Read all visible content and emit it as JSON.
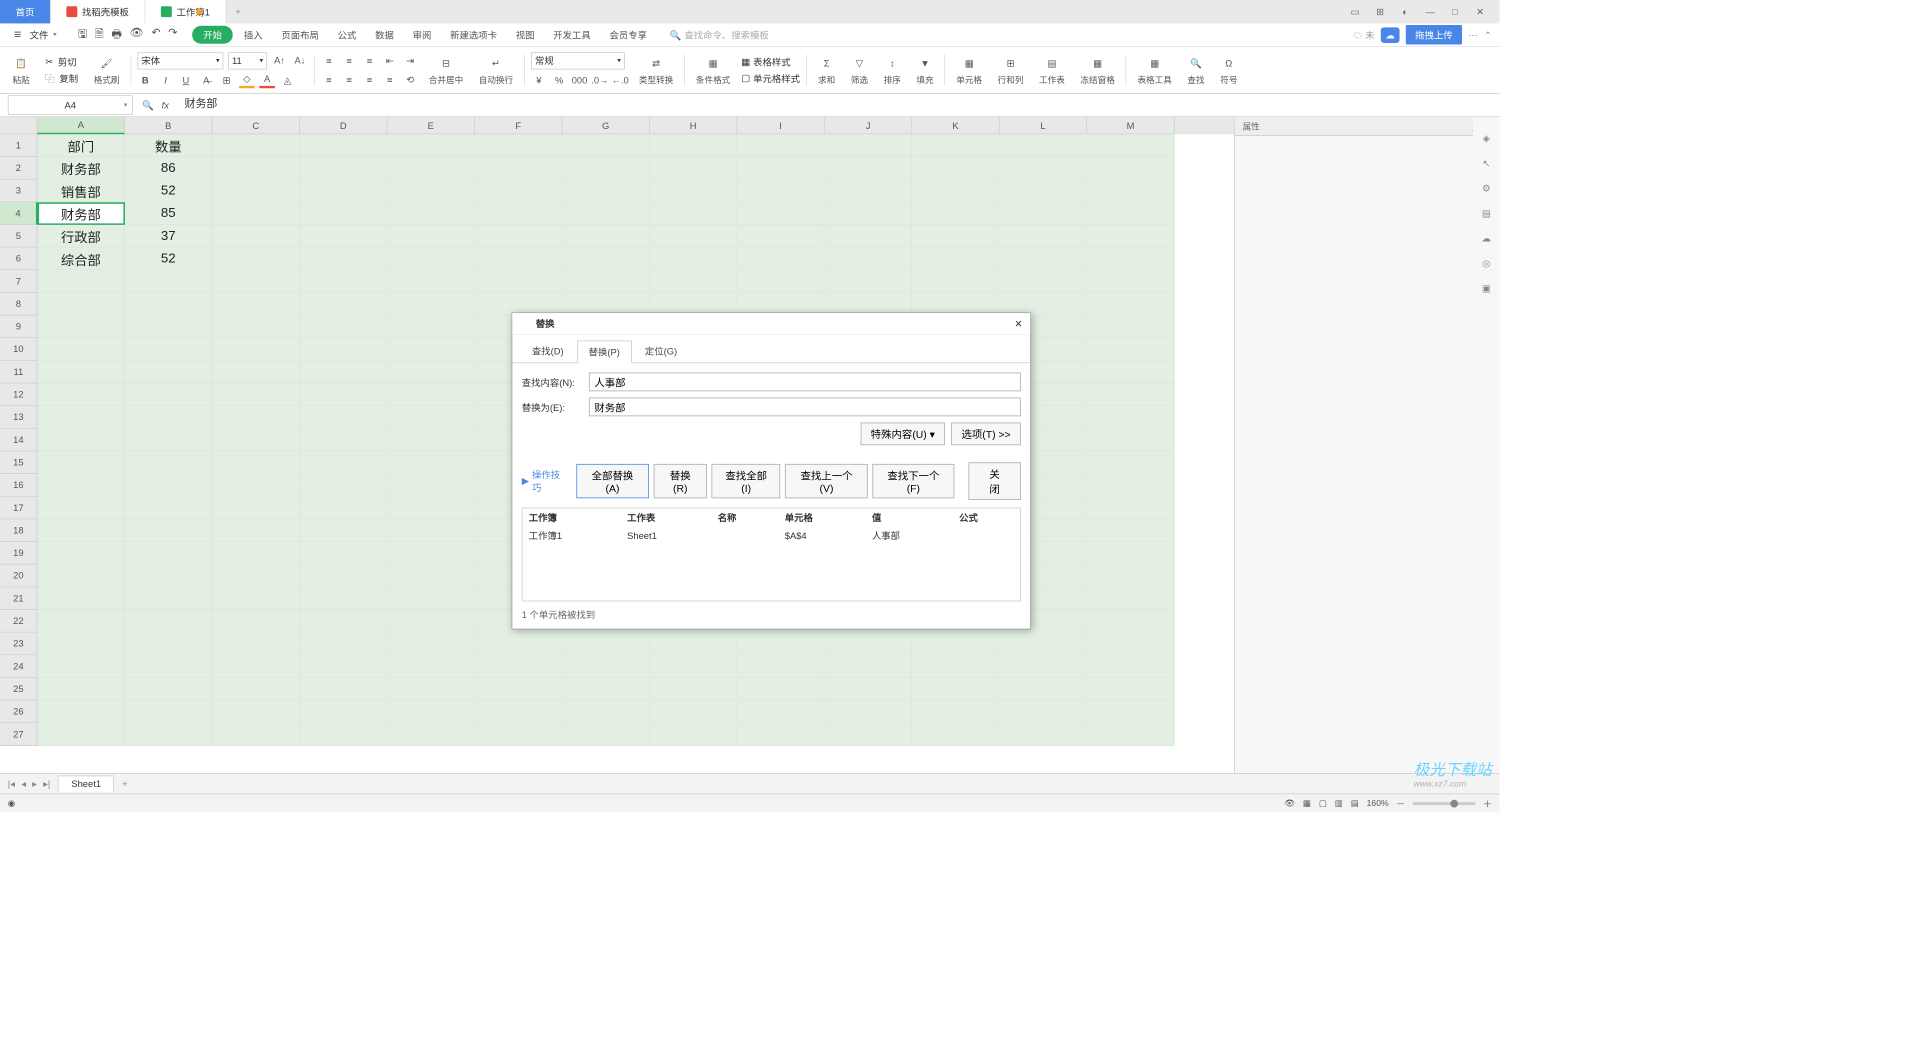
{
  "titlebar": {
    "home": "首页",
    "template": "找稻壳模板",
    "workbook": "工作簿1"
  },
  "menu": {
    "file": "文件",
    "tabs": [
      "开始",
      "插入",
      "页面布局",
      "公式",
      "数据",
      "审阅",
      "新建选项卡",
      "视图",
      "开发工具",
      "会员专享"
    ],
    "search_placeholder": "查找命令、搜索模板",
    "unsaved": "未",
    "upload": "拖拽上传"
  },
  "ribbon": {
    "paste": "粘贴",
    "cut": "剪切",
    "copy": "复制",
    "format_painter": "格式刷",
    "font_name": "宋体",
    "font_size": "11",
    "merge": "合并居中",
    "wrap": "自动换行",
    "numfmt": "常规",
    "typeconv": "类型转换",
    "condfmt": "条件格式",
    "tablestyle": "表格样式",
    "cellstyle": "单元格样式",
    "sum": "求和",
    "filter": "筛选",
    "sort": "排序",
    "fill": "填充",
    "cells": "单元格",
    "rowscols": "行和列",
    "worksheet": "工作表",
    "freeze": "冻结窗格",
    "tabletools": "表格工具",
    "find": "查找",
    "symbols": "符号"
  },
  "namebox": "A4",
  "formula": "财务部",
  "colheaders": [
    "A",
    "B",
    "C",
    "D",
    "E",
    "F",
    "G",
    "H",
    "I",
    "J",
    "K",
    "L",
    "M"
  ],
  "rowheaders": [
    "1",
    "2",
    "3",
    "4",
    "5",
    "6",
    "7",
    "8",
    "9",
    "10",
    "11",
    "12",
    "13",
    "14",
    "15",
    "16",
    "17",
    "18",
    "19",
    "20",
    "21",
    "22",
    "23",
    "24",
    "25",
    "26",
    "27"
  ],
  "cells": {
    "r1": {
      "A": "部门",
      "B": "数量"
    },
    "r2": {
      "A": "财务部",
      "B": "86"
    },
    "r3": {
      "A": "销售部",
      "B": "52"
    },
    "r4": {
      "A": "财务部",
      "B": "85"
    },
    "r5": {
      "A": "行政部",
      "B": "37"
    },
    "r6": {
      "A": "综合部",
      "B": "52"
    }
  },
  "rpanel": {
    "title": "属性"
  },
  "sheet": {
    "name": "Sheet1"
  },
  "status": {
    "zoom": "160%"
  },
  "dialog": {
    "title": "替换",
    "tabs": {
      "find": "查找(D)",
      "replace": "替换(P)",
      "goto": "定位(G)"
    },
    "find_label": "查找内容(N):",
    "replace_label": "替换为(E):",
    "find_value": "人事部",
    "replace_value": "财务部",
    "special": "特殊内容(U) ▾",
    "options": "选项(T) >>",
    "tips": "操作技巧",
    "replace_all": "全部替换(A)",
    "replace_btn": "替换(R)",
    "find_all": "查找全部(I)",
    "find_prev": "查找上一个(V)",
    "find_next": "查找下一个(F)",
    "close": "关闭",
    "cols": {
      "wb": "工作簿",
      "ws": "工作表",
      "name": "名称",
      "cell": "单元格",
      "val": "值",
      "formula": "公式"
    },
    "result": {
      "wb": "工作簿1",
      "ws": "Sheet1",
      "name": "",
      "cell": "$A$4",
      "val": "人事部",
      "formula": ""
    },
    "footer": "1 个单元格被找到"
  },
  "watermark": {
    "brand": "极光下载站",
    "url": "www.xz7.com"
  }
}
